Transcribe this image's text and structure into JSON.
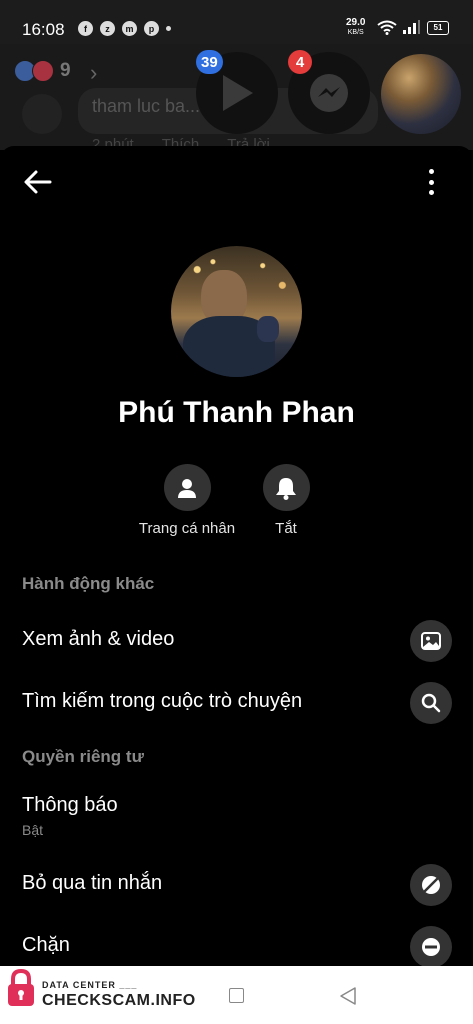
{
  "status_bar": {
    "time": "16:08",
    "speed_value": "29.0",
    "speed_unit": "KB/S",
    "battery": "51",
    "app_icons": [
      "facebook-icon",
      "zalo-icon",
      "messenger-icon",
      "picsart-icon"
    ]
  },
  "background": {
    "reaction_count": "9",
    "comment_text": "tham luc ba... ng",
    "meta": [
      "2 phút",
      "Thích",
      "Trả lời"
    ]
  },
  "chat_heads": {
    "video_badge": "39",
    "messenger_badge": "4"
  },
  "profile": {
    "name": "Phú Thanh Phan"
  },
  "quick_actions": [
    {
      "label": "Trang cá nhân",
      "icon": "person-icon"
    },
    {
      "label": "Tắt",
      "icon": "bell-icon"
    }
  ],
  "sections": {
    "actions_title": "Hành động khác",
    "privacy_title": "Quyền riêng tư"
  },
  "rows": {
    "media": {
      "label": "Xem ảnh & video",
      "icon": "image-icon"
    },
    "search": {
      "label": "Tìm kiếm trong cuộc trò chuyện",
      "icon": "search-icon"
    },
    "notifications": {
      "label": "Thông báo",
      "sub": "Bật"
    },
    "ignore": {
      "label": "Bỏ qua tin nhắn",
      "icon": "ignore-icon"
    },
    "block": {
      "label": "Chặn",
      "icon": "block-icon"
    }
  },
  "watermark": {
    "top": "DATA CENTER ___",
    "main": "CHECKSCAM.INFO"
  },
  "colors": {
    "background": "#000000",
    "icon_circle": "#333333",
    "secondary_text": "#8a8a8a",
    "video_badge": "#2f6fe0",
    "messenger_badge": "#e43b3b"
  }
}
